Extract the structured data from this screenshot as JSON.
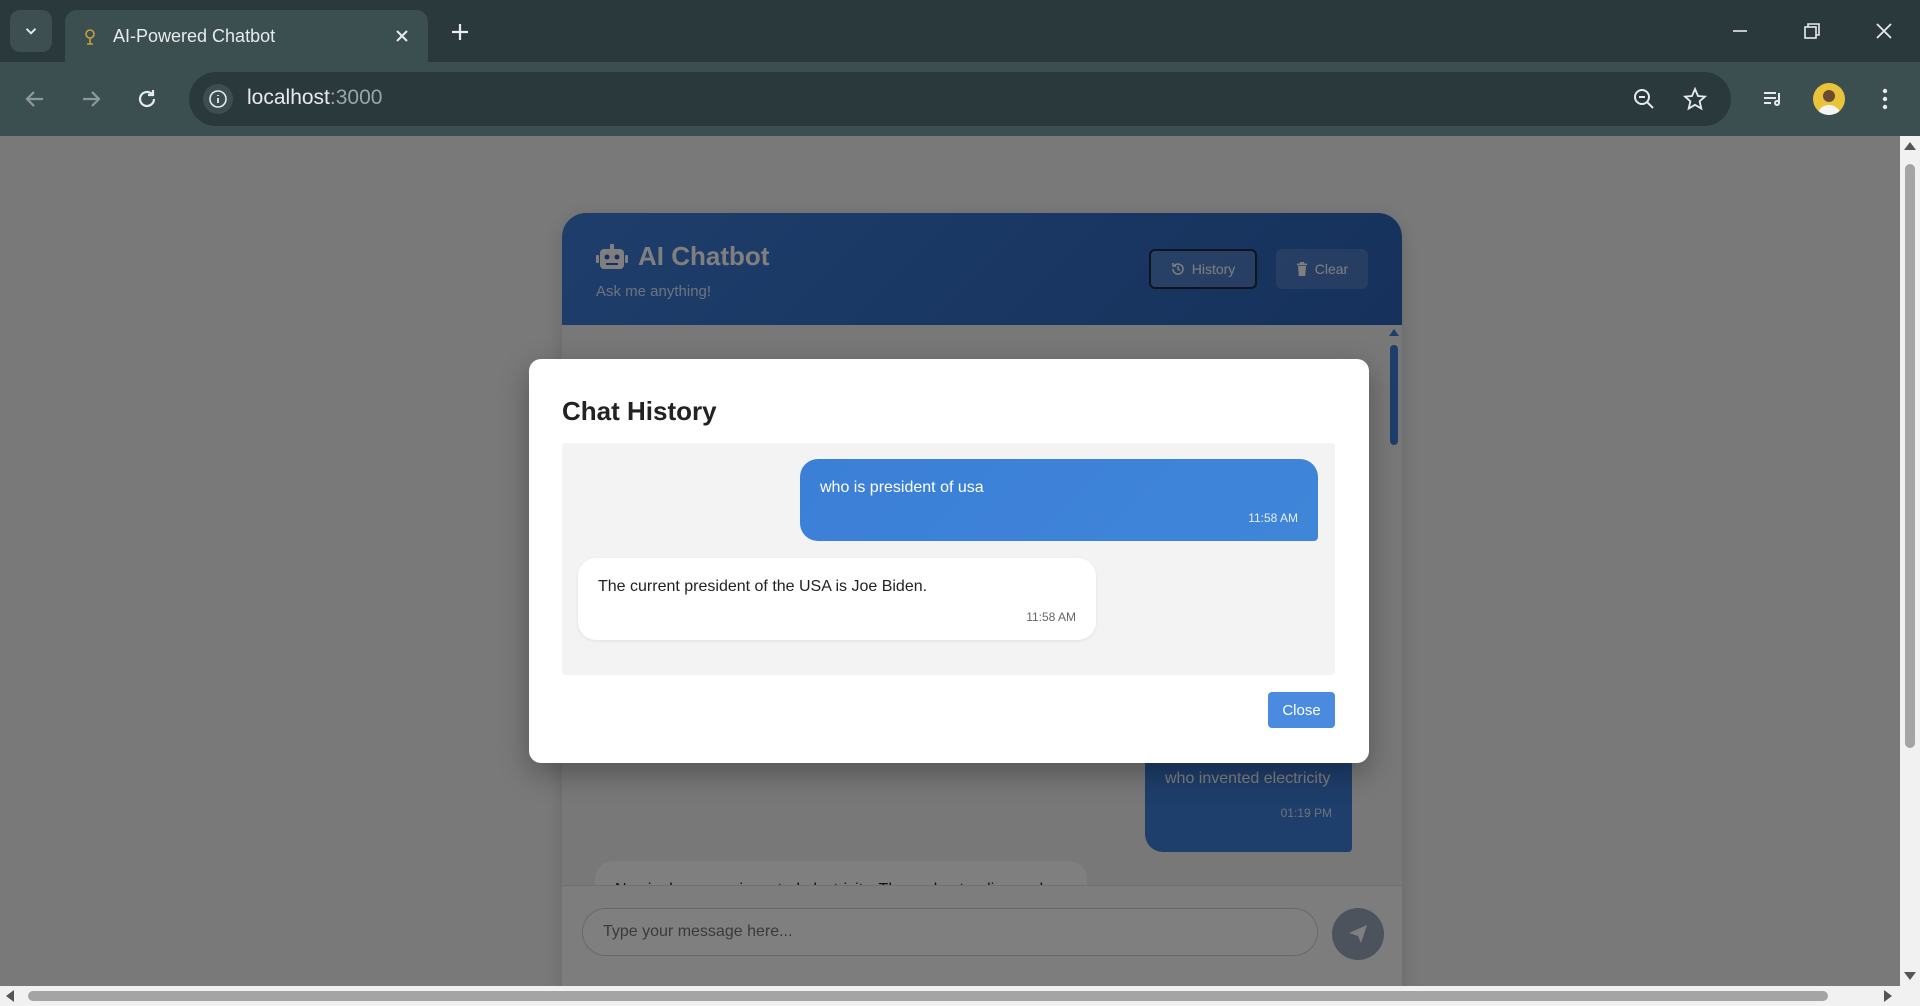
{
  "browser": {
    "tab_title": "AI-Powered Chatbot",
    "url_host": "localhost",
    "url_port": ":3000"
  },
  "app": {
    "title": "AI Chatbot",
    "subtitle": "Ask me anything!",
    "history_label": "History",
    "clear_label": "Clear",
    "input_placeholder": "Type your message here...",
    "background_messages": [
      {
        "role": "user",
        "text": "who invented electricity",
        "time": "01:19 PM"
      },
      {
        "role": "bot",
        "text": "No single person invented electricity. The understanding and"
      }
    ],
    "accent_color": "#3d7cd6"
  },
  "modal": {
    "title": "Chat History",
    "messages": [
      {
        "role": "user",
        "text": "who is president of usa",
        "time": "11:58 AM"
      },
      {
        "role": "bot",
        "text": "The current president of the USA is Joe Biden.",
        "time": "11:58 AM"
      }
    ],
    "close_label": "Close"
  }
}
